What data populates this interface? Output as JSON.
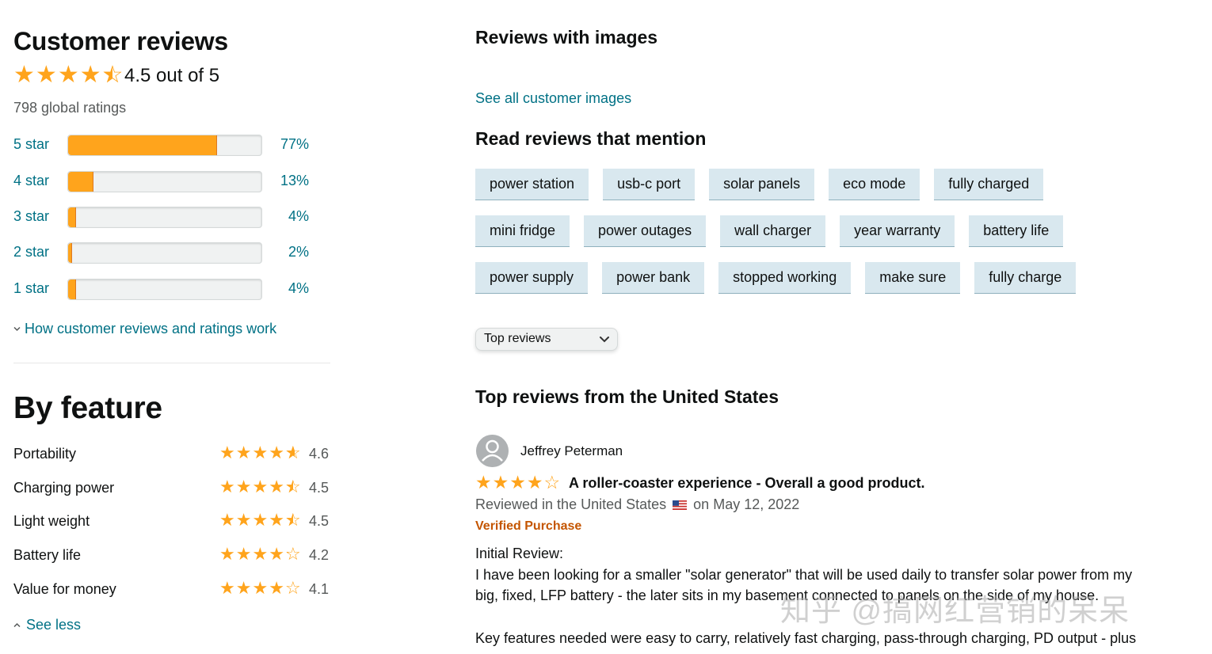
{
  "summary": {
    "title": "Customer reviews",
    "overall_rating": 4.5,
    "overall_text": "4.5 out of 5",
    "global_ratings": "798 global ratings",
    "histogram": [
      {
        "label": "5 star",
        "percent": 77,
        "percent_text": "77%"
      },
      {
        "label": "4 star",
        "percent": 13,
        "percent_text": "13%"
      },
      {
        "label": "3 star",
        "percent": 4,
        "percent_text": "4%"
      },
      {
        "label": "2 star",
        "percent": 2,
        "percent_text": "2%"
      },
      {
        "label": "1 star",
        "percent": 4,
        "percent_text": "4%"
      }
    ],
    "how_link": "How customer reviews and ratings work"
  },
  "by_feature": {
    "title": "By feature",
    "items": [
      {
        "name": "Portability",
        "rating": 4.6,
        "rating_text": "4.6"
      },
      {
        "name": "Charging power",
        "rating": 4.5,
        "rating_text": "4.5"
      },
      {
        "name": "Light weight",
        "rating": 4.5,
        "rating_text": "4.5"
      },
      {
        "name": "Battery life",
        "rating": 4.2,
        "rating_text": "4.2"
      },
      {
        "name": "Value for money",
        "rating": 4.1,
        "rating_text": "4.1"
      }
    ],
    "see_less": "See less"
  },
  "images_section": {
    "title": "Reviews with images",
    "see_all": "See all customer images"
  },
  "mentions": {
    "title": "Read reviews that mention",
    "rows": [
      [
        "power station",
        "usb-c port",
        "solar panels",
        "eco mode",
        "fully charged"
      ],
      [
        "mini fridge",
        "power outages",
        "wall charger",
        "year warranty",
        "battery life"
      ],
      [
        "power supply",
        "power bank",
        "stopped working",
        "make sure",
        "fully charge"
      ]
    ]
  },
  "sort": {
    "selected": "Top reviews"
  },
  "top_reviews": {
    "title": "Top reviews from the United States",
    "review": {
      "reviewer": "Jeffrey Peterman",
      "rating": 4,
      "title": "A roller-coaster experience - Overall a good product.",
      "meta_prefix": "Reviewed in the United States",
      "meta_suffix": "on May 12, 2022",
      "verified": "Verified Purchase",
      "body": [
        "Initial Review:",
        "I have been looking for a smaller \"solar generator\" that will be used daily to transfer solar power from my",
        "big, fixed, LFP battery - the later sits in my basement connected to panels on the side of my house.",
        "Key features needed were easy to carry, relatively fast charging, pass-through charging, PD output - plus"
      ]
    }
  },
  "watermark": "知乎 @搞网红营销的呆呆",
  "colors": {
    "star": "#ffa41c",
    "link": "#007185",
    "verified": "#c45500",
    "chip": "#d9e8ef"
  }
}
